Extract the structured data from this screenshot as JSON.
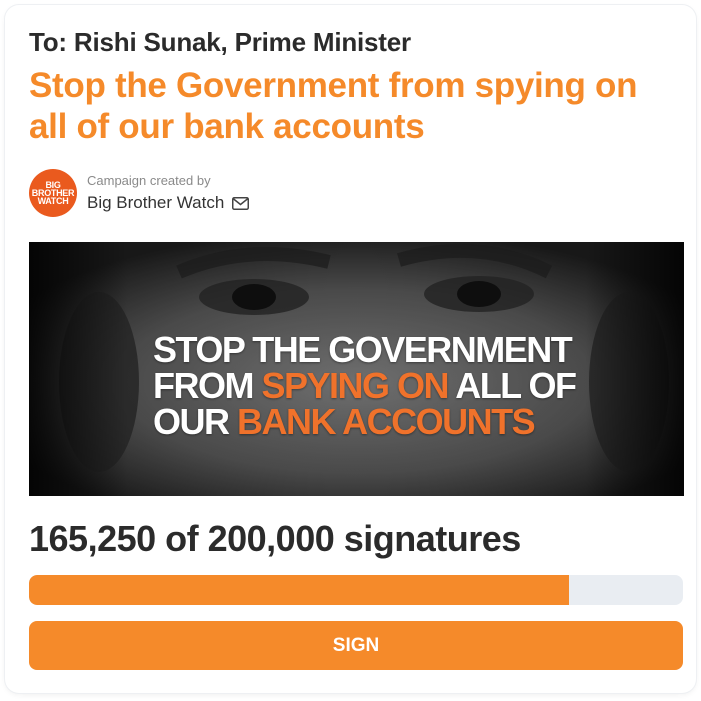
{
  "petition": {
    "to_line": "To: Rishi Sunak, Prime Minister",
    "title": "Stop the Government from spying on all of our bank accounts"
  },
  "creator": {
    "caption": "Campaign created by",
    "name": "Big Brother Watch",
    "avatar_lines": [
      "BIG",
      "BROTHER",
      "WATCH"
    ],
    "contact_icon": "mail-icon"
  },
  "hero_image": {
    "line1": "STOP THE GOVERNMENT",
    "line2_prefix": "FROM ",
    "line2_accent": "SPYING ON",
    "line2_suffix": " ALL OF",
    "line3_prefix": "OUR ",
    "line3_accent": "BANK ACCOUNTS"
  },
  "signatures": {
    "text": "165,250 of 200,000 signatures",
    "progress_fraction": 0.8263
  },
  "actions": {
    "sign_label": "SIGN"
  },
  "colors": {
    "accent": "#f58a2a",
    "avatar_bg": "#ea5a1e",
    "track": "#e9edf2"
  }
}
